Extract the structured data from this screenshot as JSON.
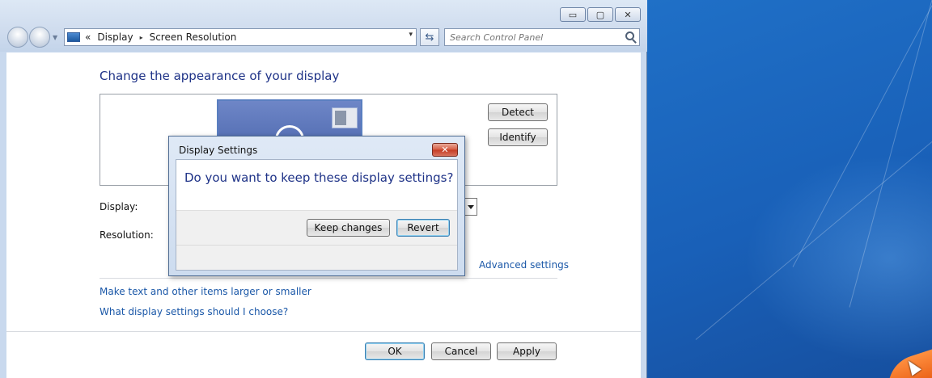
{
  "window": {
    "caption": {
      "minimize_glyph": "▭",
      "maximize_glyph": "▢",
      "close_glyph": "✕"
    },
    "address": {
      "overflow_glyph": "«",
      "crumbs": [
        "Display",
        "Screen Resolution"
      ],
      "separator_glyph": "▸",
      "dropdown_glyph": "▾"
    },
    "refresh_glyph": "⇆",
    "search": {
      "placeholder": "Search Control Panel",
      "icon": "search-icon"
    }
  },
  "page": {
    "title": "Change the appearance of your display",
    "detect_label": "Detect",
    "identify_label": "Identify",
    "display_label": "Display:",
    "resolution_label": "Resolution:",
    "advanced_link": "Advanced settings",
    "links": [
      "Make text and other items larger or smaller",
      "What display settings should I choose?"
    ],
    "buttons": {
      "ok": "OK",
      "cancel": "Cancel",
      "apply": "Apply"
    }
  },
  "dialog": {
    "title": "Display Settings",
    "close_glyph": "✕",
    "question": "Do you want to keep these display settings?",
    "keep_label": "Keep changes",
    "revert_label": "Revert"
  },
  "colors": {
    "heading": "#1e3287",
    "link": "#1b58a8",
    "close_red": "#c43a22",
    "desktop_blue": "#1f6fc6"
  }
}
